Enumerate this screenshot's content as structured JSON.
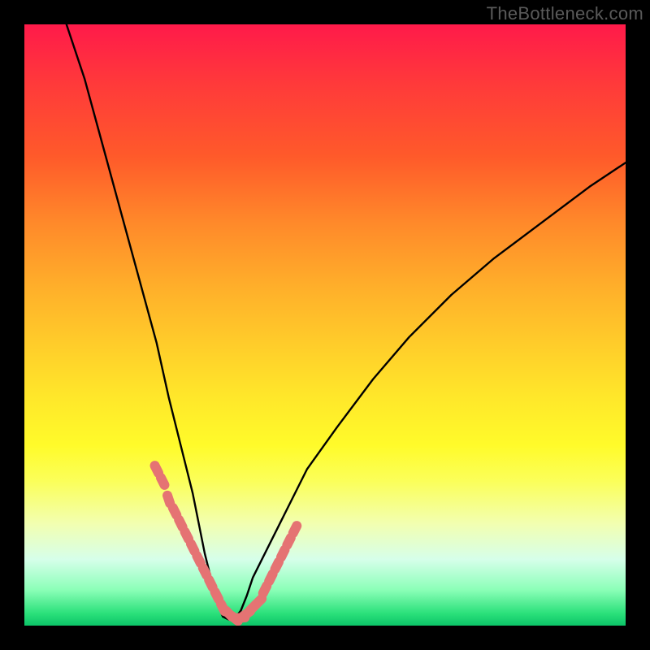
{
  "watermark": "TheBottleneck.com",
  "palette": {
    "frame": "#000000",
    "curve": "#000000",
    "marker_fill": "#e57373",
    "marker_stroke": "#d46a6a",
    "gradient_stops": [
      "#ff1a4a",
      "#ff3a3a",
      "#ff5a2a",
      "#ff892a",
      "#ffb02a",
      "#ffd22a",
      "#ffe72a",
      "#fffb2a",
      "#fbff5a",
      "#f2ffb0",
      "#d6ffea",
      "#8cffb8",
      "#2ae07a",
      "#0cc468"
    ]
  },
  "chart_data": {
    "type": "line",
    "title": "",
    "xlabel": "",
    "ylabel": "",
    "xlim": [
      0,
      100
    ],
    "ylim": [
      0,
      100
    ],
    "notes": "V-shaped curve (checkmark) over a vertical red→green gradient. Minimum ≈ 0 near x≈33. Pink rounded markers cluster along the lower V.",
    "series": [
      {
        "name": "curve",
        "x": [
          7,
          10,
          13,
          16,
          19,
          22,
          24,
          26,
          28,
          29,
          30,
          31,
          32,
          33,
          34,
          35,
          36,
          37,
          38,
          40,
          43,
          47,
          52,
          58,
          64,
          71,
          78,
          86,
          94,
          100
        ],
        "y": [
          100,
          91,
          80,
          69,
          58,
          47,
          38,
          30,
          22,
          17,
          12,
          8,
          4,
          1.5,
          1,
          1.2,
          2.5,
          5,
          8,
          12,
          18,
          26,
          33,
          41,
          48,
          55,
          61,
          67,
          73,
          77
        ]
      },
      {
        "name": "markers",
        "x": [
          22,
          23,
          24,
          25,
          26,
          27,
          28,
          29,
          30,
          31,
          32,
          33,
          34,
          35,
          36,
          37,
          38,
          39,
          40,
          41,
          42,
          43,
          44,
          45
        ],
        "y": [
          26,
          24,
          21,
          19,
          17,
          15,
          13,
          11,
          9,
          7,
          5,
          3,
          2,
          1.2,
          1.3,
          2,
          3,
          4,
          6,
          8,
          10,
          12,
          14,
          16
        ]
      }
    ]
  }
}
